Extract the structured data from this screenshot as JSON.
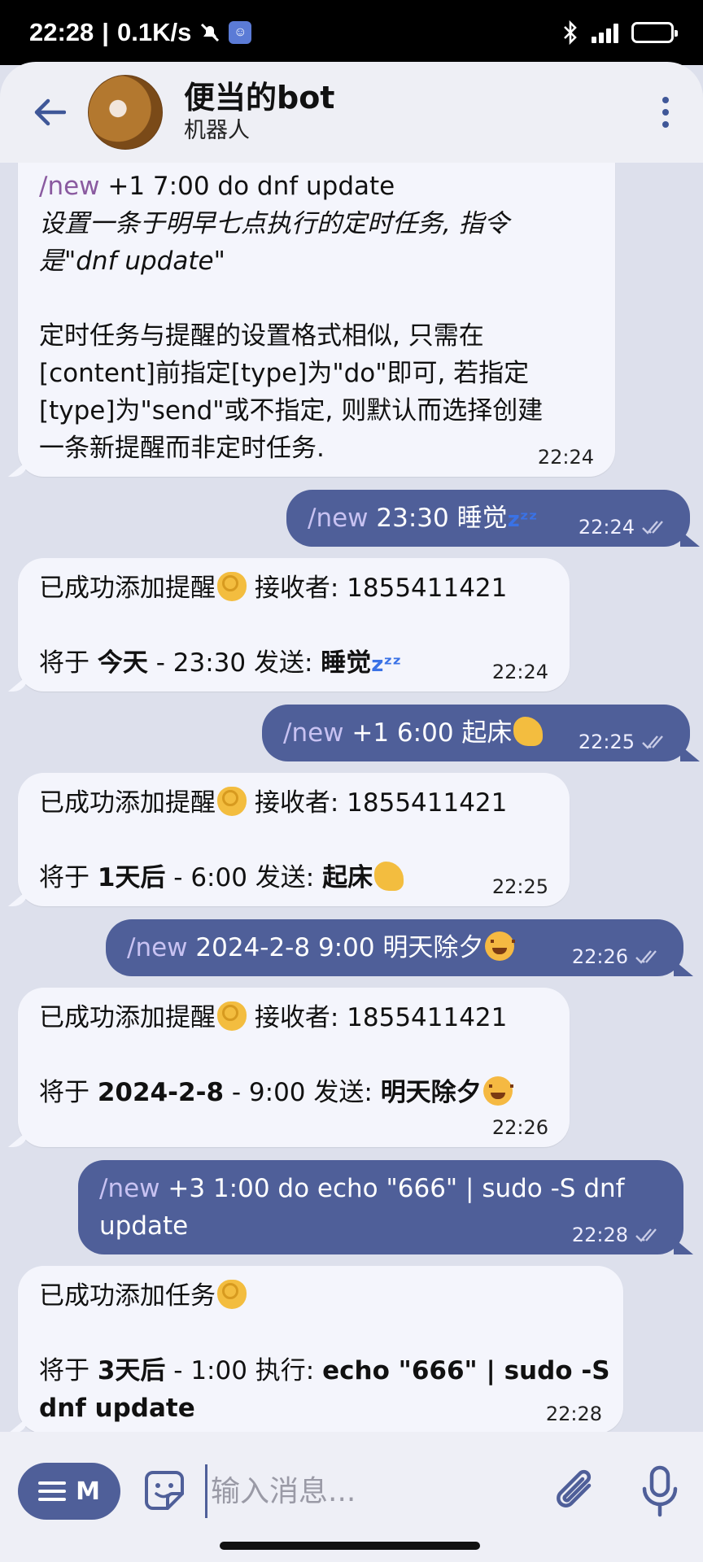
{
  "status_bar": {
    "time": "22:28",
    "separator": "|",
    "net_speed": "0.1K/s",
    "icons": [
      "mute-icon",
      "app-notification-icon",
      "bluetooth-icon",
      "signal-icon",
      "battery-icon"
    ]
  },
  "header": {
    "title": "便当的bot",
    "subtitle": "机器人"
  },
  "messages": [
    {
      "cmd": "/new",
      "lines": [
        " +1 7:00 do dnf update"
      ],
      "desc": [
        "设置一条于明早七点执行的定时任务, 指令",
        "是\"dnf update\""
      ],
      "body": [
        "定时任务与提醒的设置格式相似, 只需在",
        "[content]前指定[type]为\"do\"即可, 若指定",
        "[type]为\"send\"或不指定, 则默认而选择创建",
        "一条新提醒而非定时任务."
      ],
      "time": "22:24"
    },
    {
      "cmd": "/new",
      "text": " 23:30 睡觉",
      "time": "22:24"
    },
    {
      "l1": "已成功添加提醒",
      "l1b": " 接收者: 1855411421",
      "l2a": "将于 ",
      "l2b": "今天",
      "l2c": " - 23:30 发送: ",
      "l2d": "睡觉",
      "time": "22:24"
    },
    {
      "cmd": "/new",
      "text": " +1 6:00 起床",
      "time": "22:25"
    },
    {
      "l1": "已成功添加提醒",
      "l1b": " 接收者: 1855411421",
      "l2a": "将于 ",
      "l2b": "1天后",
      "l2c": " - 6:00 发送: ",
      "l2d": "起床",
      "time": "22:25"
    },
    {
      "cmd": "/new",
      "text": " 2024-2-8 9:00 明天除夕",
      "time": "22:26"
    },
    {
      "l1": "已成功添加提醒",
      "l1b": " 接收者: 1855411421",
      "l2a": "将于 ",
      "l2b": "2024-2-8",
      "l2c": " - 9:00 发送: ",
      "l2d": "明天除夕",
      "time": "22:26"
    },
    {
      "cmd": "/new",
      "text": " +3 1:00 do echo \"666\" | sudo -S dnf",
      "text2": "update",
      "time": "22:28"
    },
    {
      "l1": "已成功添加任务",
      "l2a": "将于 ",
      "l2b": "3天后",
      "l2c": " - 1:00 执行: ",
      "l2d": "echo \"666\" | sudo -S",
      "l3": "dnf update",
      "time": "22:28"
    }
  ],
  "input": {
    "menu_label": "M",
    "placeholder": "输入消息..."
  },
  "colors": {
    "accent": "#4f5f99",
    "incoming_bubble": "#f4f5fc",
    "chat_background": "#dde0ec"
  }
}
